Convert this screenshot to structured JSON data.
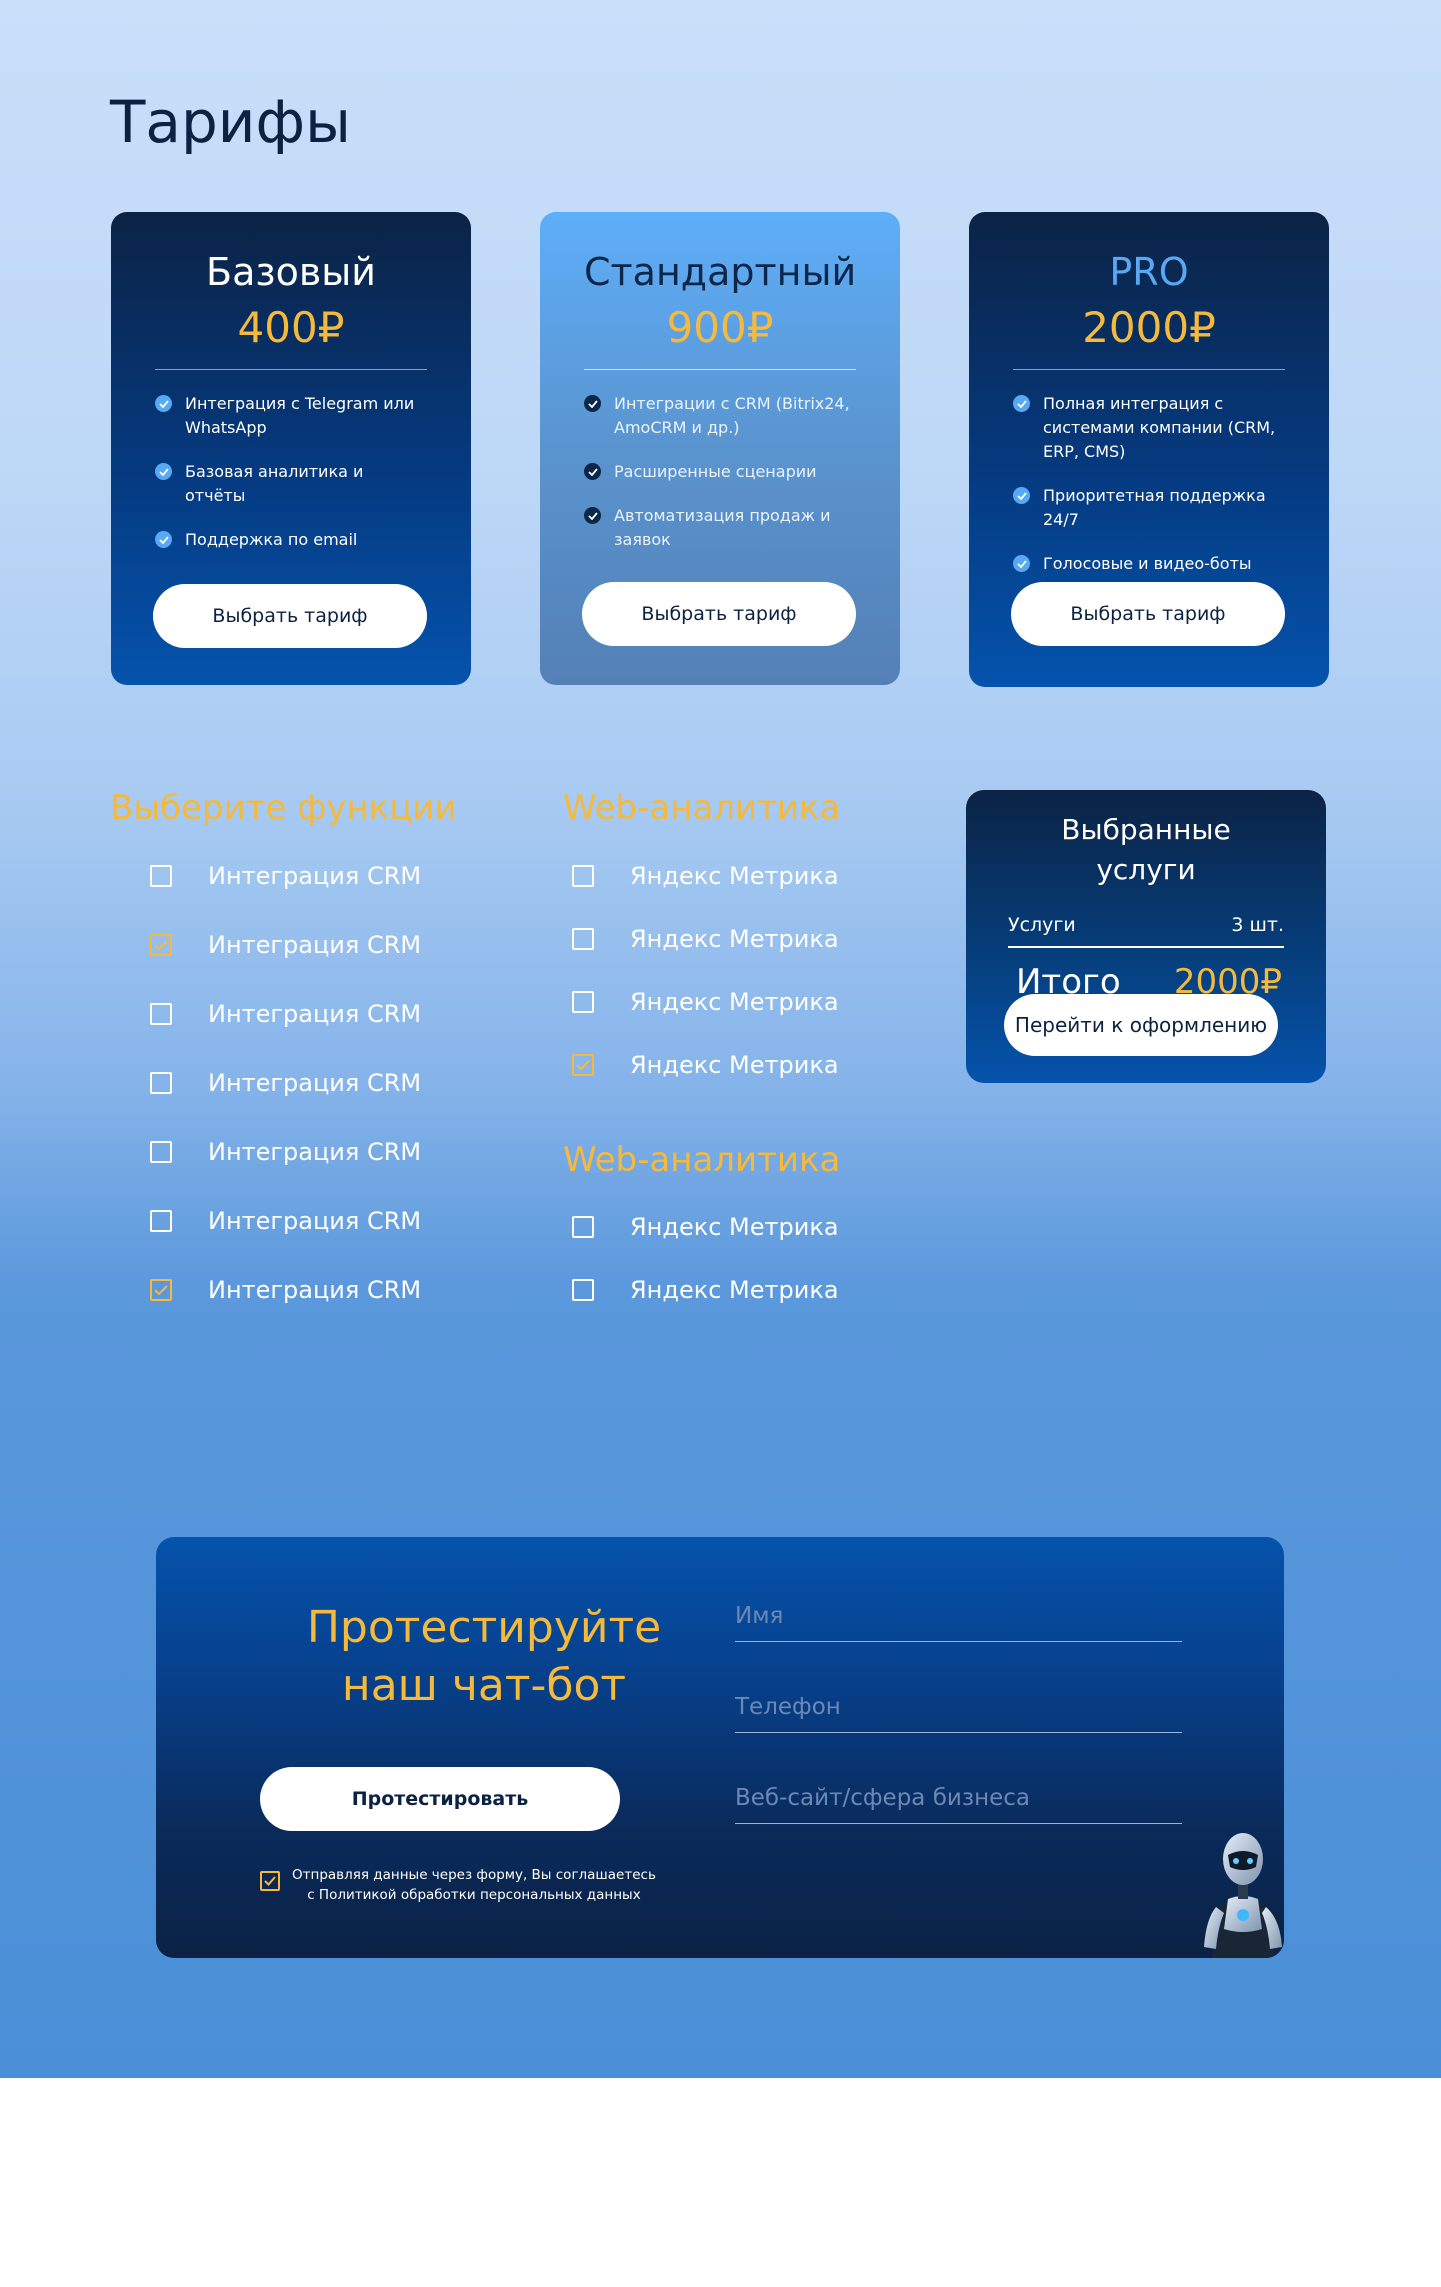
{
  "page": {
    "title": "Тарифы"
  },
  "tariffs": [
    {
      "name": "Базовый",
      "price": "400₽",
      "features": [
        "Интеграция с Telegram или WhatsApp",
        "Базовая аналитика и отчёты",
        "Поддержка по email"
      ],
      "button": "Выбрать тариф"
    },
    {
      "name": "Стандартный",
      "price": "900₽",
      "features": [
        "Интеграции с CRM (Bitrix24, AmoCRM и др.)",
        "Расширенные сценарии",
        "Автоматизация продаж и заявок"
      ],
      "button": "Выбрать тариф"
    },
    {
      "name": "PRO",
      "price": "2000₽",
      "features": [
        "Полная интеграция с системами компании (CRM, ERP, CMS)",
        "Приоритетная поддержка 24/7",
        "Голосовые и видео-боты"
      ],
      "button": "Выбрать тариф"
    }
  ],
  "functions": {
    "title": "Выберите функции",
    "items": [
      {
        "label": "Интеграция CRM",
        "checked": false
      },
      {
        "label": "Интеграция CRM",
        "checked": true
      },
      {
        "label": "Интеграция CRM",
        "checked": false
      },
      {
        "label": "Интеграция CRM",
        "checked": false
      },
      {
        "label": "Интеграция CRM",
        "checked": false
      },
      {
        "label": "Интеграция CRM",
        "checked": false
      },
      {
        "label": "Интеграция CRM",
        "checked": true
      }
    ]
  },
  "web_analytics_1": {
    "title": "Web-аналитика",
    "items": [
      {
        "label": "Яндекс Метрика",
        "checked": false
      },
      {
        "label": "Яндекс Метрика",
        "checked": false
      },
      {
        "label": "Яндекс Метрика",
        "checked": false
      },
      {
        "label": "Яндекс Метрика",
        "checked": true
      }
    ]
  },
  "web_analytics_2": {
    "title": "Web-аналитика",
    "items": [
      {
        "label": "Яндекс Метрика",
        "checked": false
      },
      {
        "label": "Яндекс Метрика",
        "checked": false
      }
    ]
  },
  "summary": {
    "title": "Выбранные услуги",
    "services_label": "Услуги",
    "services_count": "3 шт.",
    "total_label": "Итого",
    "total_value": "2000₽",
    "button": "Перейти к оформлению"
  },
  "test_bot": {
    "title_line1": "Протестируйте",
    "title_line2": "наш чат-бот",
    "button": "Протестировать",
    "consent_line1": "Отправляя данные через форму, Вы соглашаетесь",
    "consent_line2": "с Политикой обработки персональных данных",
    "consent_checked": true,
    "fields": [
      {
        "placeholder": "Имя",
        "value": ""
      },
      {
        "placeholder": "Телефон",
        "value": ""
      },
      {
        "placeholder": "Веб-сайт/сфера бизнеса",
        "value": ""
      }
    ]
  },
  "colors": {
    "accent": "#f5b93c",
    "card_dark": "#0b2345",
    "card_light": "#5eaef9",
    "heading": "#0b2240"
  }
}
